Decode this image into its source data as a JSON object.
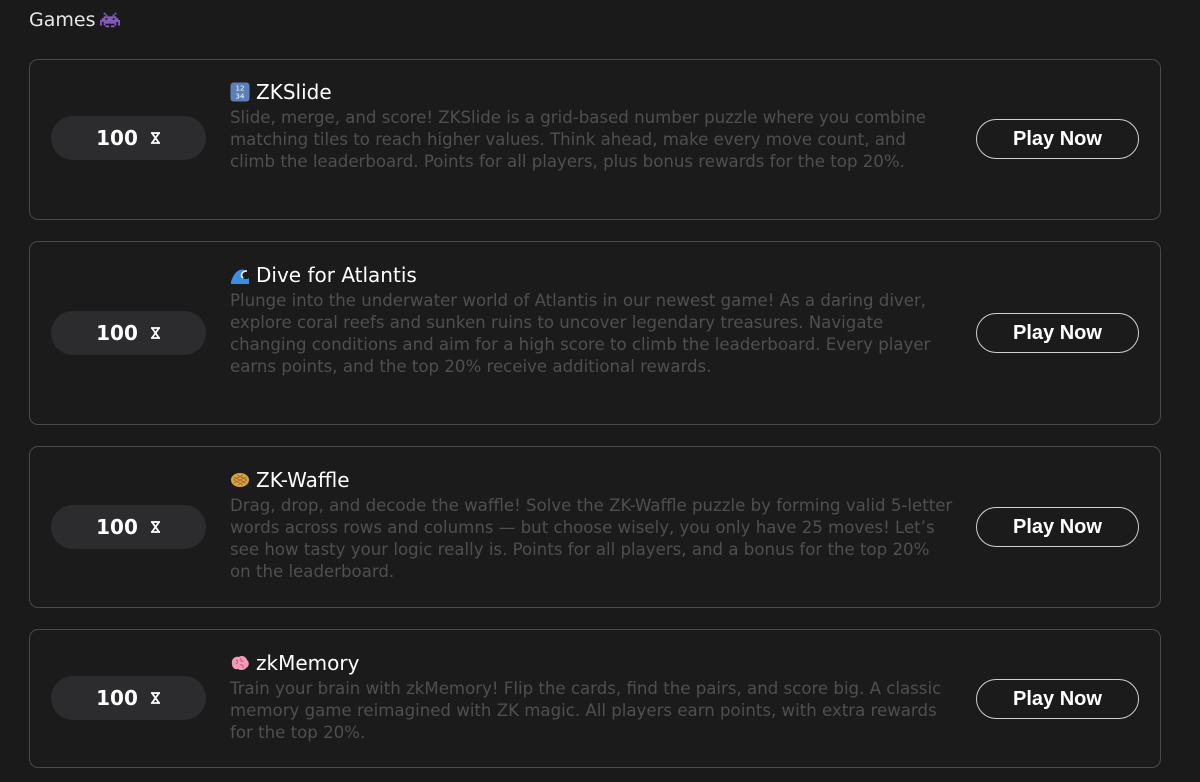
{
  "section": {
    "title": "Games",
    "title_icon": "space-invader-icon"
  },
  "games": [
    {
      "emoji_icon": "numbers-icon",
      "title": "ZKSlide",
      "description": "Slide, merge, and score! ZKSlide is a grid-based number puzzle where you combine matching tiles to reach higher values. Think ahead, make every move count, and climb the leaderboard. Points for all players, plus bonus rewards for the top 20%.",
      "points": "100",
      "play_label": "Play Now"
    },
    {
      "emoji_icon": "wave-icon",
      "title": "Dive for Atlantis",
      "description": "Plunge into the underwater world of Atlantis in our newest game! As a daring diver, explore coral reefs and sunken ruins to uncover legendary treasures. Navigate changing conditions and aim for a high score to climb the leaderboard. Every player earns points, and the top 20% receive additional rewards.",
      "points": "100",
      "play_label": "Play Now"
    },
    {
      "emoji_icon": "waffle-icon",
      "title": "ZK-Waffle",
      "description": "Drag, drop, and decode the waffle! Solve the ZK-Waffle puzzle by forming valid 5-letter words across rows and columns — but choose wisely, you only have 25 moves! Let’s see how tasty your logic really is. Points for all players, and a bonus for the top 20% on the leaderboard.",
      "points": "100",
      "play_label": "Play Now"
    },
    {
      "emoji_icon": "brain-icon",
      "title": "zkMemory",
      "description": "Train your brain with zkMemory! Flip the cards, find the pairs, and score big. A classic memory game reimagined with ZK magic. All players earn points, with extra rewards for the top 20%.",
      "points": "100",
      "play_label": "Play Now"
    }
  ],
  "colors": {
    "background": "#1a1a1b",
    "card_border": "#4a4a4c",
    "pill_bg": "#2c2c2e",
    "description_text": "#4f4f52"
  }
}
